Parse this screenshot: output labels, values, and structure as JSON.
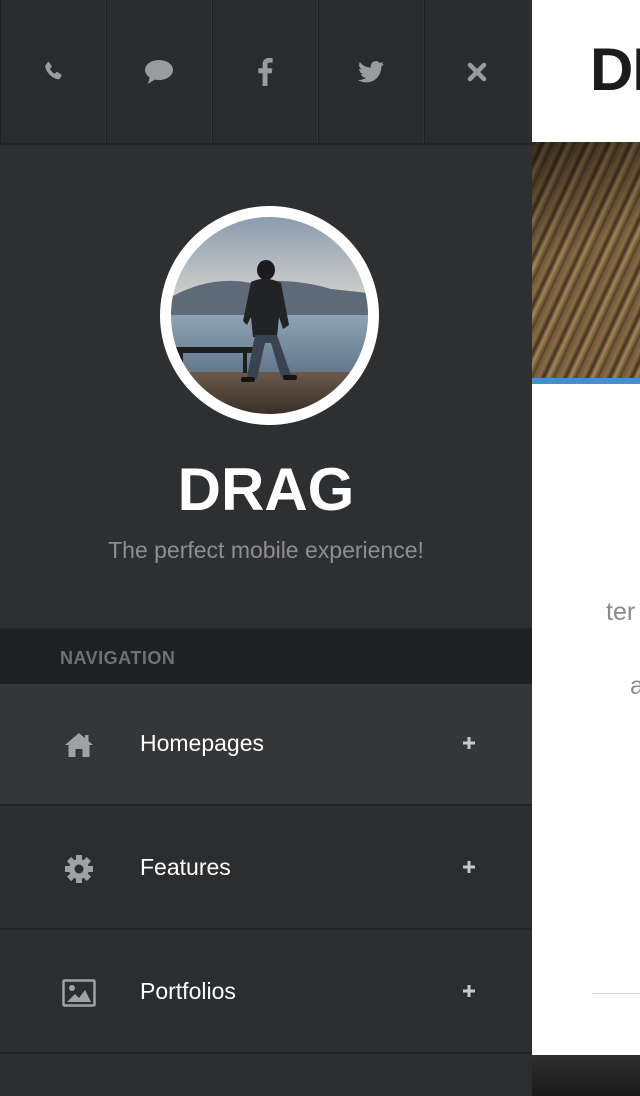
{
  "social_bar": {
    "buttons": [
      {
        "icon": "phone-icon"
      },
      {
        "icon": "chat-bubble-icon"
      },
      {
        "icon": "facebook-icon"
      },
      {
        "icon": "twitter-icon"
      },
      {
        "icon": "close-icon"
      }
    ]
  },
  "profile": {
    "avatar_alt": "profile photo",
    "brand": "DRAG",
    "tagline": "The perfect mobile experience!"
  },
  "navigation": {
    "header": "NAVIGATION",
    "items": [
      {
        "label": "Homepages",
        "icon": "home-icon",
        "active": true
      },
      {
        "label": "Features",
        "icon": "gear-icon",
        "active": false
      },
      {
        "label": "Portfolios",
        "icon": "image-icon",
        "active": false
      }
    ]
  },
  "content": {
    "title_partial": "DI",
    "text_fragment_1": "ter",
    "text_fragment_2": "a"
  },
  "colors": {
    "accent": "#3d91d6",
    "sidebar_bg": "#2c2d2e",
    "nav_header_bg": "#1f2022",
    "active_item_bg": "#353637"
  }
}
